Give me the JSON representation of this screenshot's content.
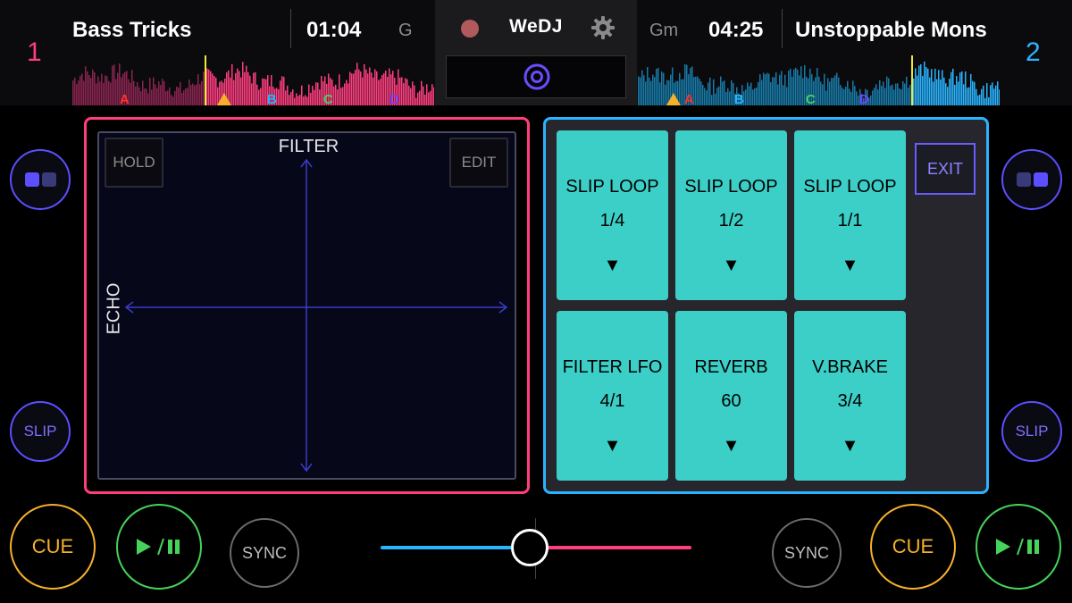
{
  "deck1": {
    "number": "1",
    "title": "Bass Tricks",
    "time": "01:04",
    "key": "G",
    "cue_letters": [
      "A",
      "B",
      "C",
      "D"
    ],
    "color": "#ff3d7f"
  },
  "deck2": {
    "number": "2",
    "title": "Unstoppable Mons",
    "time": "04:25",
    "key": "Gm",
    "cue_letters": [
      "A",
      "B",
      "C",
      "D"
    ],
    "color": "#2ab4ff"
  },
  "header": {
    "logo": "WeDJ",
    "record_icon": "record-icon",
    "settings_icon": "gear-icon",
    "center_icon": "target-icon"
  },
  "xy_pad": {
    "hold_label": "HOLD",
    "edit_label": "EDIT",
    "y_axis_label": "FILTER",
    "x_axis_label": "ECHO"
  },
  "fx_pads": [
    {
      "name": "SLIP LOOP",
      "value": "1/4",
      "arrow": "▼"
    },
    {
      "name": "SLIP LOOP",
      "value": "1/2",
      "arrow": "▼"
    },
    {
      "name": "SLIP LOOP",
      "value": "1/1",
      "arrow": "▼"
    },
    {
      "name": "FILTER LFO",
      "value": "4/1",
      "arrow": "▼"
    },
    {
      "name": "REVERB",
      "value": "60",
      "arrow": "▼"
    },
    {
      "name": "V.BRAKE",
      "value": "3/4",
      "arrow": "▼"
    }
  ],
  "exit_label": "EXIT",
  "side": {
    "left_mode_icon": "dual-pad-icon",
    "right_mode_icon": "dual-pad-icon",
    "slip_label": "SLIP"
  },
  "transport": {
    "cue_label": "CUE",
    "sync_label": "SYNC",
    "play_icon": "play-pause-icon"
  },
  "crossfader": {
    "position": 0.48
  },
  "colors": {
    "deck1_accent": "#ff3d7f",
    "deck2_accent": "#2ab4ff",
    "fx_pad": "#3ccfc7",
    "cue": "#f7b02b",
    "play": "#45d35a",
    "slip": "#5b4fff"
  }
}
